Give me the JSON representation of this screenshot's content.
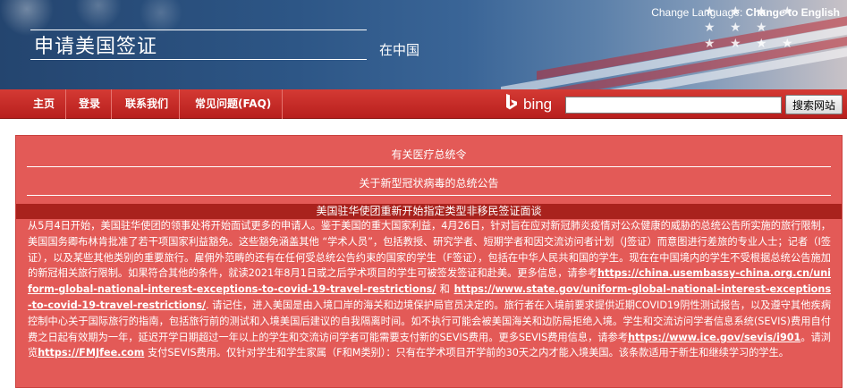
{
  "header": {
    "site_title": "申请美国签证",
    "site_subtitle": "在中国",
    "change_language_label": "Change Language:",
    "change_language_link": "Change to English"
  },
  "nav": {
    "items": [
      {
        "label": "主页"
      },
      {
        "label": "登录"
      },
      {
        "label": "联系我们"
      },
      {
        "label": "常见问题(FAQ)"
      }
    ]
  },
  "search": {
    "provider": "bing",
    "placeholder": "",
    "button_label": "搜索网站"
  },
  "notices": {
    "link1": "有关医疗总统令",
    "link2": "关于新型冠状病毒的总统公告",
    "headline": "美国驻华使团重新开始指定类型非移民签证面谈",
    "body_p1": "从5月4日开始，美国驻华使团的领事处将开始面试更多的申请人。鉴于美国的重大国家利益，4月26日，针对旨在应对新冠肺炎疫情对公众健康的威胁的总统公告所实施的旅行限制，美国国务卿布林肯批准了若干项国家利益豁免。这些豁免涵盖其他 “学术人员”，包括教授、研究学者、短期学者和因交流访问者计划（J签证）而意图进行差旅的专业人士；记者（I签证），以及某些其他类别的重要旅行。雇佣外范畴的还有在任何受总统公告约束的国家的学生（F签证），包括在中华人民共和国的学生。现在在中国境内的学生不受根据总统公告施加的新冠相关旅行限制。如果符合其他的条件，就读2021年8月1日或之后学术项目的学生可被签发签证和赴美。更多信息，请参考",
    "url1": "https://china.usembassy-china.org.cn/uniform-global-national-interest-exceptions-to-covid-19-travel-restrictions/",
    "and_word": " 和 ",
    "url2": "https://www.state.gov/uniform-global-national-interest-exceptions-to-covid-19-travel-restrictions/",
    "body_p2": ". 请记住，进入美国是由入境口岸的海关和边境保护局官员决定的。旅行者在入境前要求提供近期COVID19阴性测试报告，以及遵守其他疾病控制中心关于国际旅行的指南，包括旅行前的测试和入境美国后建议的自我隔离时间。如不执行可能会被美国海关和边防局拒绝入境。学生和交流访问学者信息系统(SEVIS)费用自付费之日起有效期为一年，延迟开学日期超过一年以上的学生和交流访问学者可能需要支付新的SEVIS费用。更多SEVIS费用信息，请参考",
    "url3": "https://www.ice.gov/sevis/i901",
    "body_p3": "。请浏览",
    "url4": "https://FMJfee.com",
    "body_p4": " 支付SEVIS费用。仅针对学生和学生家属（F和M类别）：只有在学术项目开学前的30天之内才能入境美国。该条款适用于新生和继续学习的学生。"
  }
}
